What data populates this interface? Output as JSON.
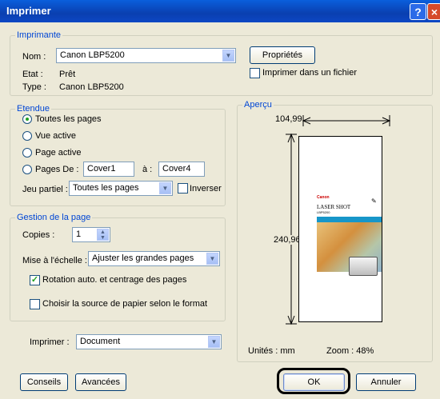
{
  "window": {
    "title": "Imprimer",
    "help_glyph": "?",
    "close_glyph": "×"
  },
  "printer": {
    "group_label": "Imprimante",
    "name_label": "Nom :",
    "name_value": "Canon LBP5200",
    "state_label": "Etat :",
    "state_value": "Prêt",
    "type_label": "Type :",
    "type_value": "Canon LBP5200",
    "properties_button": "Propriétés",
    "print_to_file_label": "Imprimer dans un fichier",
    "print_to_file_checked": false
  },
  "range": {
    "group_label": "Etendue",
    "all_pages": "Toutes les pages",
    "current_view": "Vue active",
    "current_page": "Page active",
    "pages_label": "Pages De :",
    "from_value": "Cover1",
    "to_label": "à :",
    "to_value": "Cover4",
    "subset_label": "Jeu partiel :",
    "subset_value": "Toutes les pages",
    "reverse_label": "Inverser",
    "selected": "all_pages"
  },
  "page_handling": {
    "group_label": "Gestion de la page",
    "copies_label": "Copies :",
    "copies_value": "1",
    "scaling_label": "Mise à l'échelle :",
    "scaling_value": "Ajuster les grandes pages",
    "auto_rotate_label": "Rotation auto. et centrage des pages",
    "auto_rotate_checked": true,
    "paper_source_label": "Choisir la source de papier selon le format",
    "paper_source_checked": false
  },
  "preview": {
    "group_label": "Aperçu",
    "width_value": "104,99",
    "height_value": "240,96",
    "units": "Unités : mm",
    "zoom": "Zoom : 48%",
    "page_brand": "Canon",
    "page_title": "LASER SHOT",
    "page_model": "LBP5200"
  },
  "print_what": {
    "label": "Imprimer :",
    "value": "Document"
  },
  "buttons": {
    "tips": "Conseils",
    "advanced": "Avancées",
    "ok": "OK",
    "cancel": "Annuler"
  },
  "colors": {
    "title_bar": "#0a4fd0",
    "group_label": "#0046d5",
    "face": "#ece9d8"
  }
}
